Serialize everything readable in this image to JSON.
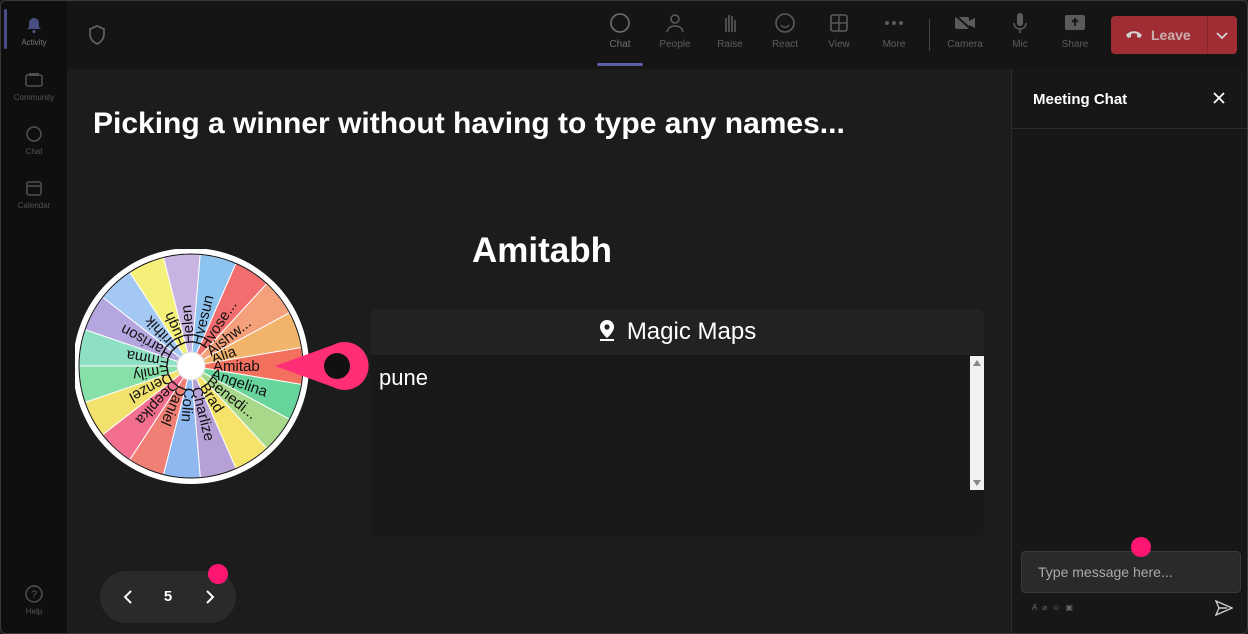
{
  "rail": {
    "items": [
      {
        "label": "Activity",
        "icon": "bell-icon"
      },
      {
        "label": "Community",
        "icon": "community-icon"
      },
      {
        "label": "Chat",
        "icon": "chat-icon"
      },
      {
        "label": "Calendar",
        "icon": "calendar-icon"
      }
    ],
    "help": {
      "label": "Help",
      "icon": "help-icon"
    }
  },
  "toolbar": {
    "buttons": [
      {
        "label": "Chat",
        "icon": "chat-bubble-icon"
      },
      {
        "label": "People",
        "icon": "people-icon"
      },
      {
        "label": "Raise",
        "icon": "raise-hand-icon"
      },
      {
        "label": "React",
        "icon": "smiley-icon"
      },
      {
        "label": "View",
        "icon": "grid-view-icon"
      },
      {
        "label": "More",
        "icon": "more-dots-icon"
      },
      {
        "label": "Camera",
        "icon": "camera-off-icon"
      },
      {
        "label": "Mic",
        "icon": "mic-icon"
      },
      {
        "label": "Share",
        "icon": "share-screen-icon"
      }
    ],
    "leave_label": "Leave"
  },
  "stage": {
    "title": "Picking a winner without having to type any names...",
    "winner": "Amitabh",
    "wheel_names": [
      "Alia",
      "Amitab",
      "Angelina",
      "Benedi...",
      "Brad",
      "Charlize",
      "Colin",
      "Daniel",
      "Deepika",
      "Denzel",
      "Emily",
      "Emma",
      "Harrison",
      "Hrithik",
      "Hugh",
      "Helen",
      "Hyesun",
      "Hyose...",
      "Aishw..."
    ],
    "map": {
      "title": "Magic Maps",
      "text": "pune"
    },
    "pager": {
      "page": "5"
    }
  },
  "chat": {
    "title": "Meeting Chat",
    "placeholder": "Type message here..."
  },
  "colors": {
    "accent": "#ff1673",
    "leave": "#c4343c",
    "active_indicator": "#7b80e0"
  }
}
